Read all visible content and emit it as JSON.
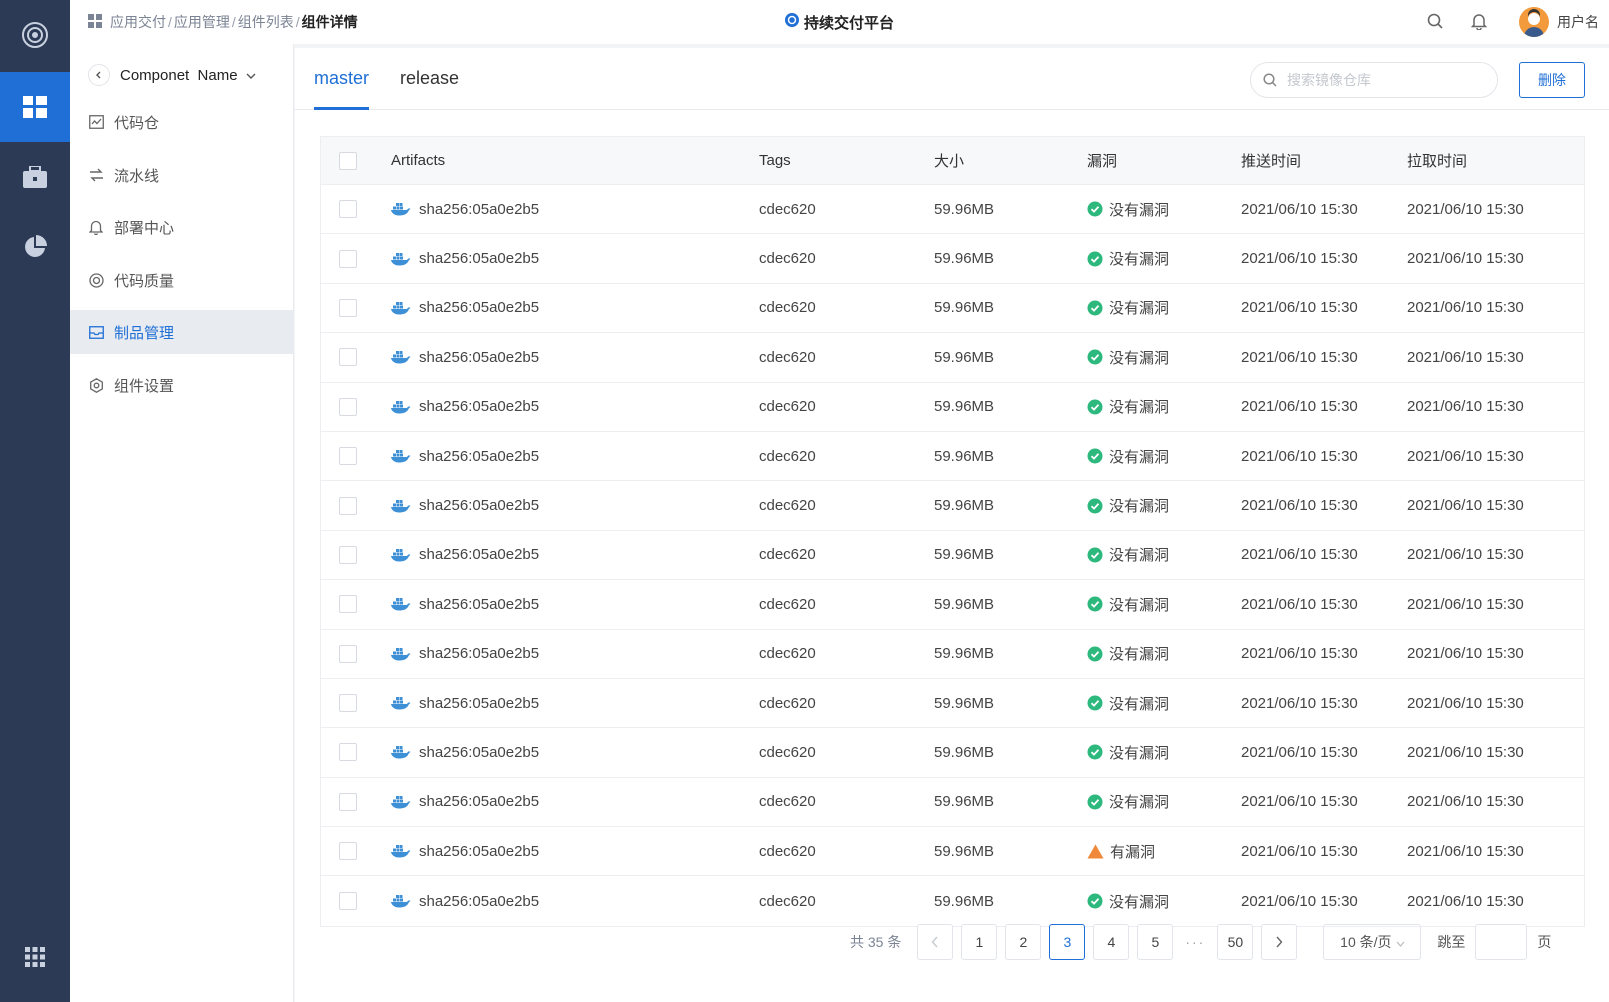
{
  "rail": {
    "items": [
      {
        "icon": "dashboard-icon",
        "active": true
      },
      {
        "icon": "toolbox-icon",
        "active": false
      },
      {
        "icon": "pie-chart-icon",
        "active": false
      }
    ]
  },
  "header": {
    "breadcrumbs": [
      "应用交付",
      "应用管理",
      "组件列表"
    ],
    "separator": "/",
    "current": "组件详情",
    "platform_title": "持续交付平台",
    "username": "用户名"
  },
  "sidenav": {
    "component_name": "Componet  Name",
    "items": [
      {
        "label": "代码仓",
        "icon": "repo-icon",
        "active": false
      },
      {
        "label": "流水线",
        "icon": "pipeline-icon",
        "active": false
      },
      {
        "label": "部署中心",
        "icon": "bell-icon",
        "active": false
      },
      {
        "label": "代码质量",
        "icon": "quality-icon",
        "active": false
      },
      {
        "label": "制品管理",
        "icon": "artifact-icon",
        "active": true
      },
      {
        "label": "组件设置",
        "icon": "gear-icon",
        "active": false
      }
    ]
  },
  "main": {
    "tabs": [
      {
        "label": "master",
        "active": true
      },
      {
        "label": "release",
        "active": false
      }
    ],
    "search_placeholder": "搜索镜像仓库",
    "delete_label": "删除"
  },
  "table": {
    "columns": [
      "Artifacts",
      "Tags",
      "大小",
      "漏洞",
      "推送时间",
      "拉取时间"
    ],
    "rows": [
      {
        "artifact": "sha256:05a0e2b5",
        "tag": "cdec620",
        "size": "59.96MB",
        "vuln": "没有漏洞",
        "vuln_status": "ok",
        "push": "2021/06/10 15:30",
        "pull": "2021/06/10 15:30"
      },
      {
        "artifact": "sha256:05a0e2b5",
        "tag": "cdec620",
        "size": "59.96MB",
        "vuln": "没有漏洞",
        "vuln_status": "ok",
        "push": "2021/06/10 15:30",
        "pull": "2021/06/10 15:30"
      },
      {
        "artifact": "sha256:05a0e2b5",
        "tag": "cdec620",
        "size": "59.96MB",
        "vuln": "没有漏洞",
        "vuln_status": "ok",
        "push": "2021/06/10 15:30",
        "pull": "2021/06/10 15:30"
      },
      {
        "artifact": "sha256:05a0e2b5",
        "tag": "cdec620",
        "size": "59.96MB",
        "vuln": "没有漏洞",
        "vuln_status": "ok",
        "push": "2021/06/10 15:30",
        "pull": "2021/06/10 15:30"
      },
      {
        "artifact": "sha256:05a0e2b5",
        "tag": "cdec620",
        "size": "59.96MB",
        "vuln": "没有漏洞",
        "vuln_status": "ok",
        "push": "2021/06/10 15:30",
        "pull": "2021/06/10 15:30"
      },
      {
        "artifact": "sha256:05a0e2b5",
        "tag": "cdec620",
        "size": "59.96MB",
        "vuln": "没有漏洞",
        "vuln_status": "ok",
        "push": "2021/06/10 15:30",
        "pull": "2021/06/10 15:30"
      },
      {
        "artifact": "sha256:05a0e2b5",
        "tag": "cdec620",
        "size": "59.96MB",
        "vuln": "没有漏洞",
        "vuln_status": "ok",
        "push": "2021/06/10 15:30",
        "pull": "2021/06/10 15:30"
      },
      {
        "artifact": "sha256:05a0e2b5",
        "tag": "cdec620",
        "size": "59.96MB",
        "vuln": "没有漏洞",
        "vuln_status": "ok",
        "push": "2021/06/10 15:30",
        "pull": "2021/06/10 15:30"
      },
      {
        "artifact": "sha256:05a0e2b5",
        "tag": "cdec620",
        "size": "59.96MB",
        "vuln": "没有漏洞",
        "vuln_status": "ok",
        "push": "2021/06/10 15:30",
        "pull": "2021/06/10 15:30"
      },
      {
        "artifact": "sha256:05a0e2b5",
        "tag": "cdec620",
        "size": "59.96MB",
        "vuln": "没有漏洞",
        "vuln_status": "ok",
        "push": "2021/06/10 15:30",
        "pull": "2021/06/10 15:30"
      },
      {
        "artifact": "sha256:05a0e2b5",
        "tag": "cdec620",
        "size": "59.96MB",
        "vuln": "没有漏洞",
        "vuln_status": "ok",
        "push": "2021/06/10 15:30",
        "pull": "2021/06/10 15:30"
      },
      {
        "artifact": "sha256:05a0e2b5",
        "tag": "cdec620",
        "size": "59.96MB",
        "vuln": "没有漏洞",
        "vuln_status": "ok",
        "push": "2021/06/10 15:30",
        "pull": "2021/06/10 15:30"
      },
      {
        "artifact": "sha256:05a0e2b5",
        "tag": "cdec620",
        "size": "59.96MB",
        "vuln": "没有漏洞",
        "vuln_status": "ok",
        "push": "2021/06/10 15:30",
        "pull": "2021/06/10 15:30"
      },
      {
        "artifact": "sha256:05a0e2b5",
        "tag": "cdec620",
        "size": "59.96MB",
        "vuln": "有漏洞",
        "vuln_status": "warn",
        "push": "2021/06/10 15:30",
        "pull": "2021/06/10 15:30"
      },
      {
        "artifact": "sha256:05a0e2b5",
        "tag": "cdec620",
        "size": "59.96MB",
        "vuln": "没有漏洞",
        "vuln_status": "ok",
        "push": "2021/06/10 15:30",
        "pull": "2021/06/10 15:30"
      }
    ]
  },
  "pagination": {
    "total": "共 35 条",
    "pages": [
      "1",
      "2",
      "3",
      "4",
      "5"
    ],
    "ellipsis": "···",
    "last_page": "50",
    "current": "3",
    "page_size": "10 条/页",
    "jump_label": "跳至",
    "page_unit": "页"
  },
  "colors": {
    "rail_bg": "#2c3a55",
    "accent": "#1f6fd6",
    "ok": "#2db87d",
    "warn": "#f0883a",
    "whale": "#3d8fd6"
  }
}
